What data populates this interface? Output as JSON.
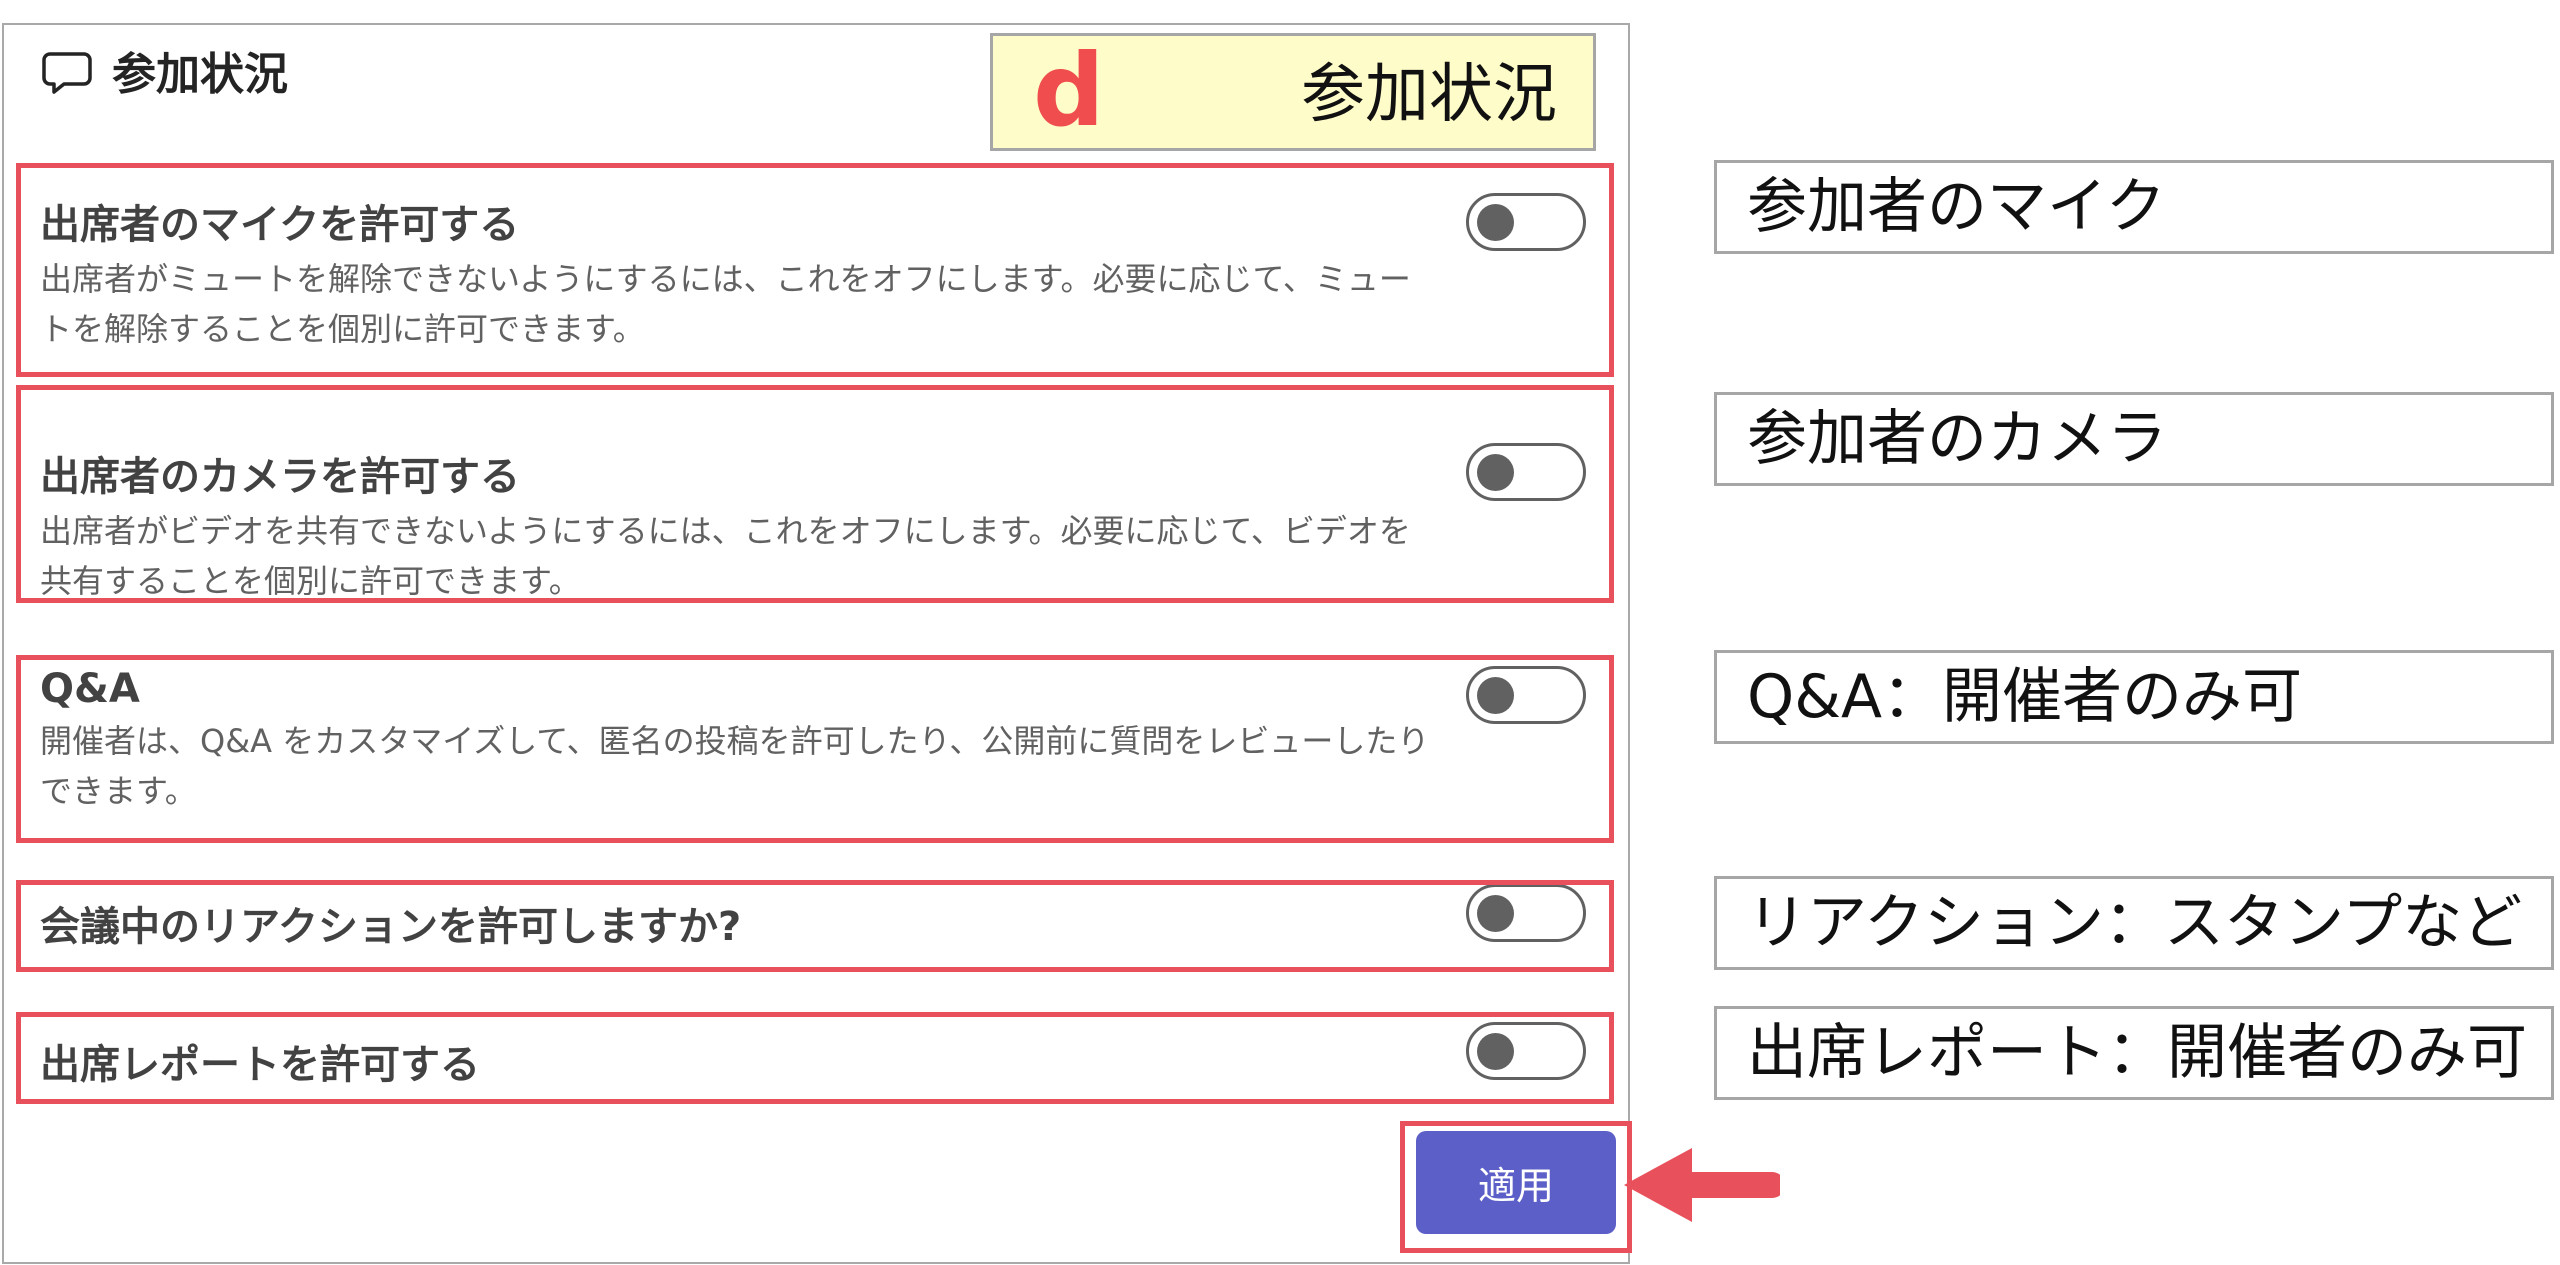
{
  "panel": {
    "title": "参加状況",
    "icon": "chat-bubble-icon"
  },
  "tag": {
    "letter": "d",
    "text": "参加状況",
    "letter_color": "#f04e4e",
    "background": "#fefcc8"
  },
  "settings": [
    {
      "label": "出席者のマイクを許可する",
      "description": "出席者がミュートを解除できないようにするには、これをオフにします。必要に応じて、ミュートを解除することを個別に許可できます。",
      "enabled": false
    },
    {
      "label": "出席者のカメラを許可する",
      "description": "出席者がビデオを共有できないようにするには、これをオフにします。必要に応じて、ビデオを共有することを個別に許可できます。",
      "enabled": false
    },
    {
      "label": "Q&A",
      "description": "開催者は、Q&A をカスタマイズして、匿名の投稿を許可したり、公開前に質問をレビューしたりできます。",
      "enabled": false
    },
    {
      "label": "会議中のリアクションを許可しますか?",
      "description": "",
      "enabled": false
    },
    {
      "label": "出席レポートを許可する",
      "description": "",
      "enabled": false
    }
  ],
  "apply_button": {
    "label": "適用",
    "color": "#5b5fc7"
  },
  "annotations": {
    "highlight_color": "#e8505b",
    "notes": [
      "参加者のマイク",
      "参加者のカメラ",
      "Q&A：開催者のみ可",
      "リアクション：スタンプなど",
      "出席レポート：開催者のみ可"
    ]
  }
}
